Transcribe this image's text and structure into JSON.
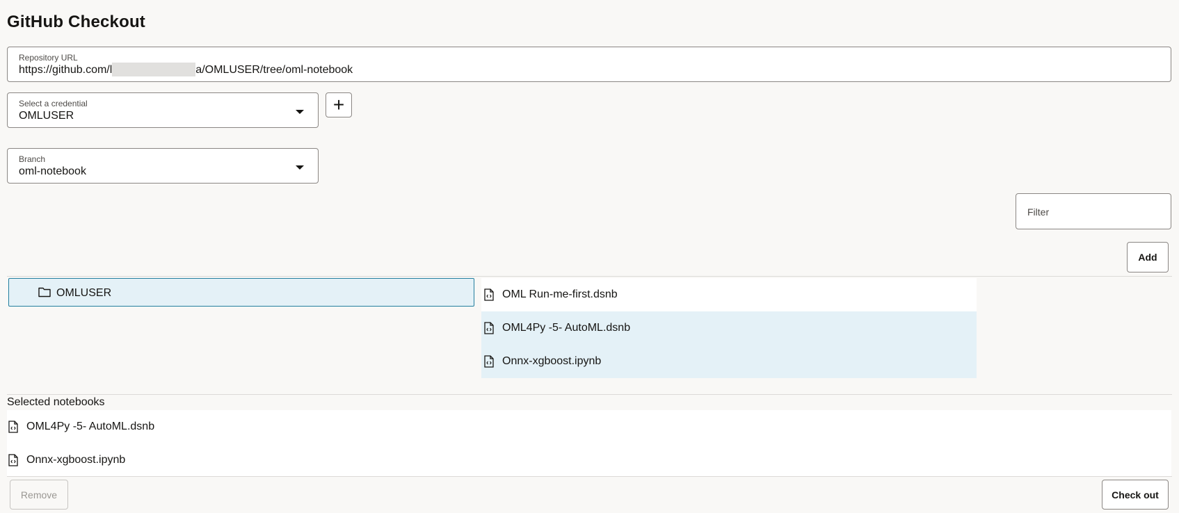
{
  "page": {
    "title": "GitHub Checkout"
  },
  "repo": {
    "label": "Repository URL",
    "value_prefix": "https://github.com/",
    "value_prefix_char": "l",
    "value_suffix": "a/OMLUSER/tree/oml-notebook"
  },
  "credential": {
    "label": "Select a credential",
    "value": "OMLUSER"
  },
  "branch": {
    "label": "Branch",
    "value": "oml-notebook"
  },
  "filter": {
    "placeholder": "Filter"
  },
  "actions": {
    "add_label": "Add",
    "remove_label": "Remove",
    "checkout_label": "Check out"
  },
  "tree": {
    "folder": "OMLUSER"
  },
  "files": [
    {
      "name": "OML Run-me-first.dsnb",
      "selected": false
    },
    {
      "name": "OML4Py -5- AutoML.dsnb",
      "selected": true
    },
    {
      "name": "Onnx-xgboost.ipynb",
      "selected": true
    }
  ],
  "selected_notebooks": {
    "label": "Selected notebooks",
    "items": [
      "OML4Py -5- AutoML.dsnb",
      "Onnx-xgboost.ipynb"
    ]
  },
  "colors": {
    "accent": "#227e9e",
    "selection": "#e4f1f7",
    "background": "#f9f8f6"
  }
}
